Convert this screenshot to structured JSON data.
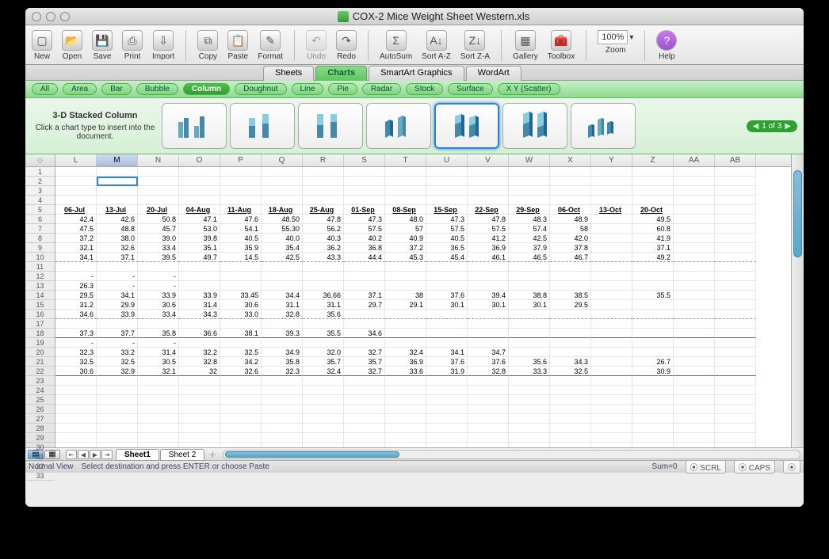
{
  "title": "COX-2 Mice Weight Sheet Western.xls",
  "toolbar": [
    {
      "id": "new",
      "label": "New",
      "glyph": "▢"
    },
    {
      "id": "open",
      "label": "Open",
      "glyph": "📂"
    },
    {
      "id": "save",
      "label": "Save",
      "glyph": "💾"
    },
    {
      "id": "print",
      "label": "Print",
      "glyph": "⎙"
    },
    {
      "id": "import",
      "label": "Import",
      "glyph": "⇩"
    },
    {
      "id": "copy",
      "label": "Copy",
      "glyph": "⧉"
    },
    {
      "id": "paste",
      "label": "Paste",
      "glyph": "📋"
    },
    {
      "id": "format",
      "label": "Format",
      "glyph": "✎"
    },
    {
      "id": "undo",
      "label": "Undo",
      "glyph": "↶",
      "disabled": true
    },
    {
      "id": "redo",
      "label": "Redo",
      "glyph": "↷"
    },
    {
      "id": "autosum",
      "label": "AutoSum",
      "glyph": "Σ"
    },
    {
      "id": "sortaz",
      "label": "Sort A-Z",
      "glyph": "A↓"
    },
    {
      "id": "sortza",
      "label": "Sort Z-A",
      "glyph": "Z↓"
    },
    {
      "id": "gallery",
      "label": "Gallery",
      "glyph": "▦"
    },
    {
      "id": "toolbox",
      "label": "Toolbox",
      "glyph": "🧰"
    }
  ],
  "zoom": "100%",
  "help_label": "Help",
  "zoom_label": "Zoom",
  "ribbon_tabs": [
    "Sheets",
    "Charts",
    "SmartArt Graphics",
    "WordArt"
  ],
  "ribbon_active": 1,
  "chart_cats": [
    "All",
    "Area",
    "Bar",
    "Bubble",
    "Column",
    "Doughnut",
    "Line",
    "Pie",
    "Radar",
    "Stock",
    "Surface",
    "X Y (Scatter)"
  ],
  "chart_cat_active": 4,
  "chart_desc_title": "3-D Stacked Column",
  "chart_desc_body": "Click a chart type to insert into the document.",
  "pager": "1 of 3",
  "col_letters": [
    "L",
    "M",
    "N",
    "O",
    "P",
    "Q",
    "R",
    "S",
    "T",
    "U",
    "V",
    "W",
    "X",
    "Y",
    "Z",
    "AA",
    "AB"
  ],
  "selected_col": 1,
  "selected_row": 1,
  "row_start": 1,
  "row_end": 33,
  "headers_row": 5,
  "headers": [
    "06-Jul",
    "13-Jul",
    "20-Jul",
    "04-Aug",
    "11-Aug",
    "18-Aug",
    "25-Aug",
    "01-Sep",
    "08-Sep",
    "15-Sep",
    "22-Sep",
    "29-Sep",
    "06-Oct",
    "13-Oct",
    "20-Oct"
  ],
  "rows": {
    "6": [
      "42.4",
      "42.6",
      "50.8",
      "47.1",
      "47.6",
      "48.50",
      "47.8",
      "47.3",
      "48.0",
      "47.3",
      "47.8",
      "48.3",
      "48.9",
      "",
      "49.5"
    ],
    "7": [
      "47.5",
      "48.8",
      "45.7",
      "53.0",
      "54.1",
      "55.30",
      "56.2",
      "57.5",
      "57",
      "57.5",
      "57.5",
      "57.4",
      "58",
      "",
      "60.8"
    ],
    "8": [
      "37.2",
      "38.0",
      "39.0",
      "39.8",
      "40.5",
      "40.0",
      "40.3",
      "40.2",
      "40.9",
      "40.5",
      "41.2",
      "42.5",
      "42.0",
      "",
      "41.9"
    ],
    "9": [
      "32.1",
      "32.6",
      "33.4",
      "35.1",
      "35.9",
      "35.4",
      "36.2",
      "36.8",
      "37.2",
      "36.5",
      "36.9",
      "37.9",
      "37.8",
      "",
      "37.1"
    ],
    "10": [
      "34.1",
      "37.1",
      "39.5",
      "49.7",
      "14.5",
      "42.5",
      "43.3",
      "44.4",
      "45.3",
      "45.4",
      "46.1",
      "46.5",
      "46.7",
      "",
      "49.2"
    ],
    "12": [
      "-",
      "-",
      "-",
      "",
      "",
      "",
      "",
      "",
      "",
      "",
      "",
      "",
      "",
      "",
      ""
    ],
    "13": [
      "26.3",
      "-",
      "-",
      "",
      "",
      "",
      "",
      "",
      "",
      "",
      "",
      "",
      "",
      "",
      ""
    ],
    "14": [
      "29.5",
      "34.1",
      "33.9",
      "33.9",
      "33.45",
      "34.4",
      "36.66",
      "37.1",
      "38",
      "37.6",
      "39.4",
      "38.8",
      "38.5",
      "",
      "35.5"
    ],
    "15": [
      "31.2",
      "29.9",
      "30.6",
      "31.4",
      "30.6",
      "31.1",
      "31.1",
      "29.7",
      "29.1",
      "30.1",
      "30.1",
      "30.1",
      "29.5",
      "",
      ""
    ],
    "16": [
      "34.6",
      "33.9",
      "33.4",
      "34.3",
      "33.0",
      "32.8",
      "35.6",
      "",
      "",
      "",
      "",
      "",
      "",
      "",
      ""
    ],
    "18": [
      "37.3",
      "37.7",
      "35.8",
      "36.6",
      "38.1",
      "39.3",
      "35.5",
      "34.6",
      "",
      "",
      "",
      "",
      "",
      "",
      ""
    ],
    "19": [
      "-",
      "-",
      "-",
      "",
      "",
      "",
      "",
      "",
      "",
      "",
      "",
      "",
      "",
      "",
      ""
    ],
    "20": [
      "32.3",
      "33.2",
      "31.4",
      "32.2",
      "32.5",
      "34.9",
      "32.0",
      "32.7",
      "32.4",
      "34.1",
      "34.7",
      "",
      "",
      "",
      ""
    ],
    "21": [
      "32.5",
      "32.5",
      "30.5",
      "32.8",
      "34.2",
      "35.8",
      "35.7",
      "35.7",
      "36.9",
      "37.6",
      "37.6",
      "35.6",
      "34.3",
      "",
      "26.7"
    ],
    "22": [
      "30.6",
      "32.9",
      "32.1",
      "32",
      "32.6",
      "32.3",
      "32.4",
      "32.7",
      "33.6",
      "31.9",
      "32.8",
      "33.3",
      "32.5",
      "",
      "30.9"
    ]
  },
  "dashed_rows": [
    10,
    16
  ],
  "solid_rows": [
    18,
    22
  ],
  "sheet_tabs": [
    "Sheet1",
    "Sheet 2"
  ],
  "sheet_active": 0,
  "status_view": "Normal View",
  "status_msg": "Select destination and press ENTER or choose Paste",
  "status_sum": "Sum=0",
  "status_scrl": "SCRL",
  "status_caps": "CAPS"
}
